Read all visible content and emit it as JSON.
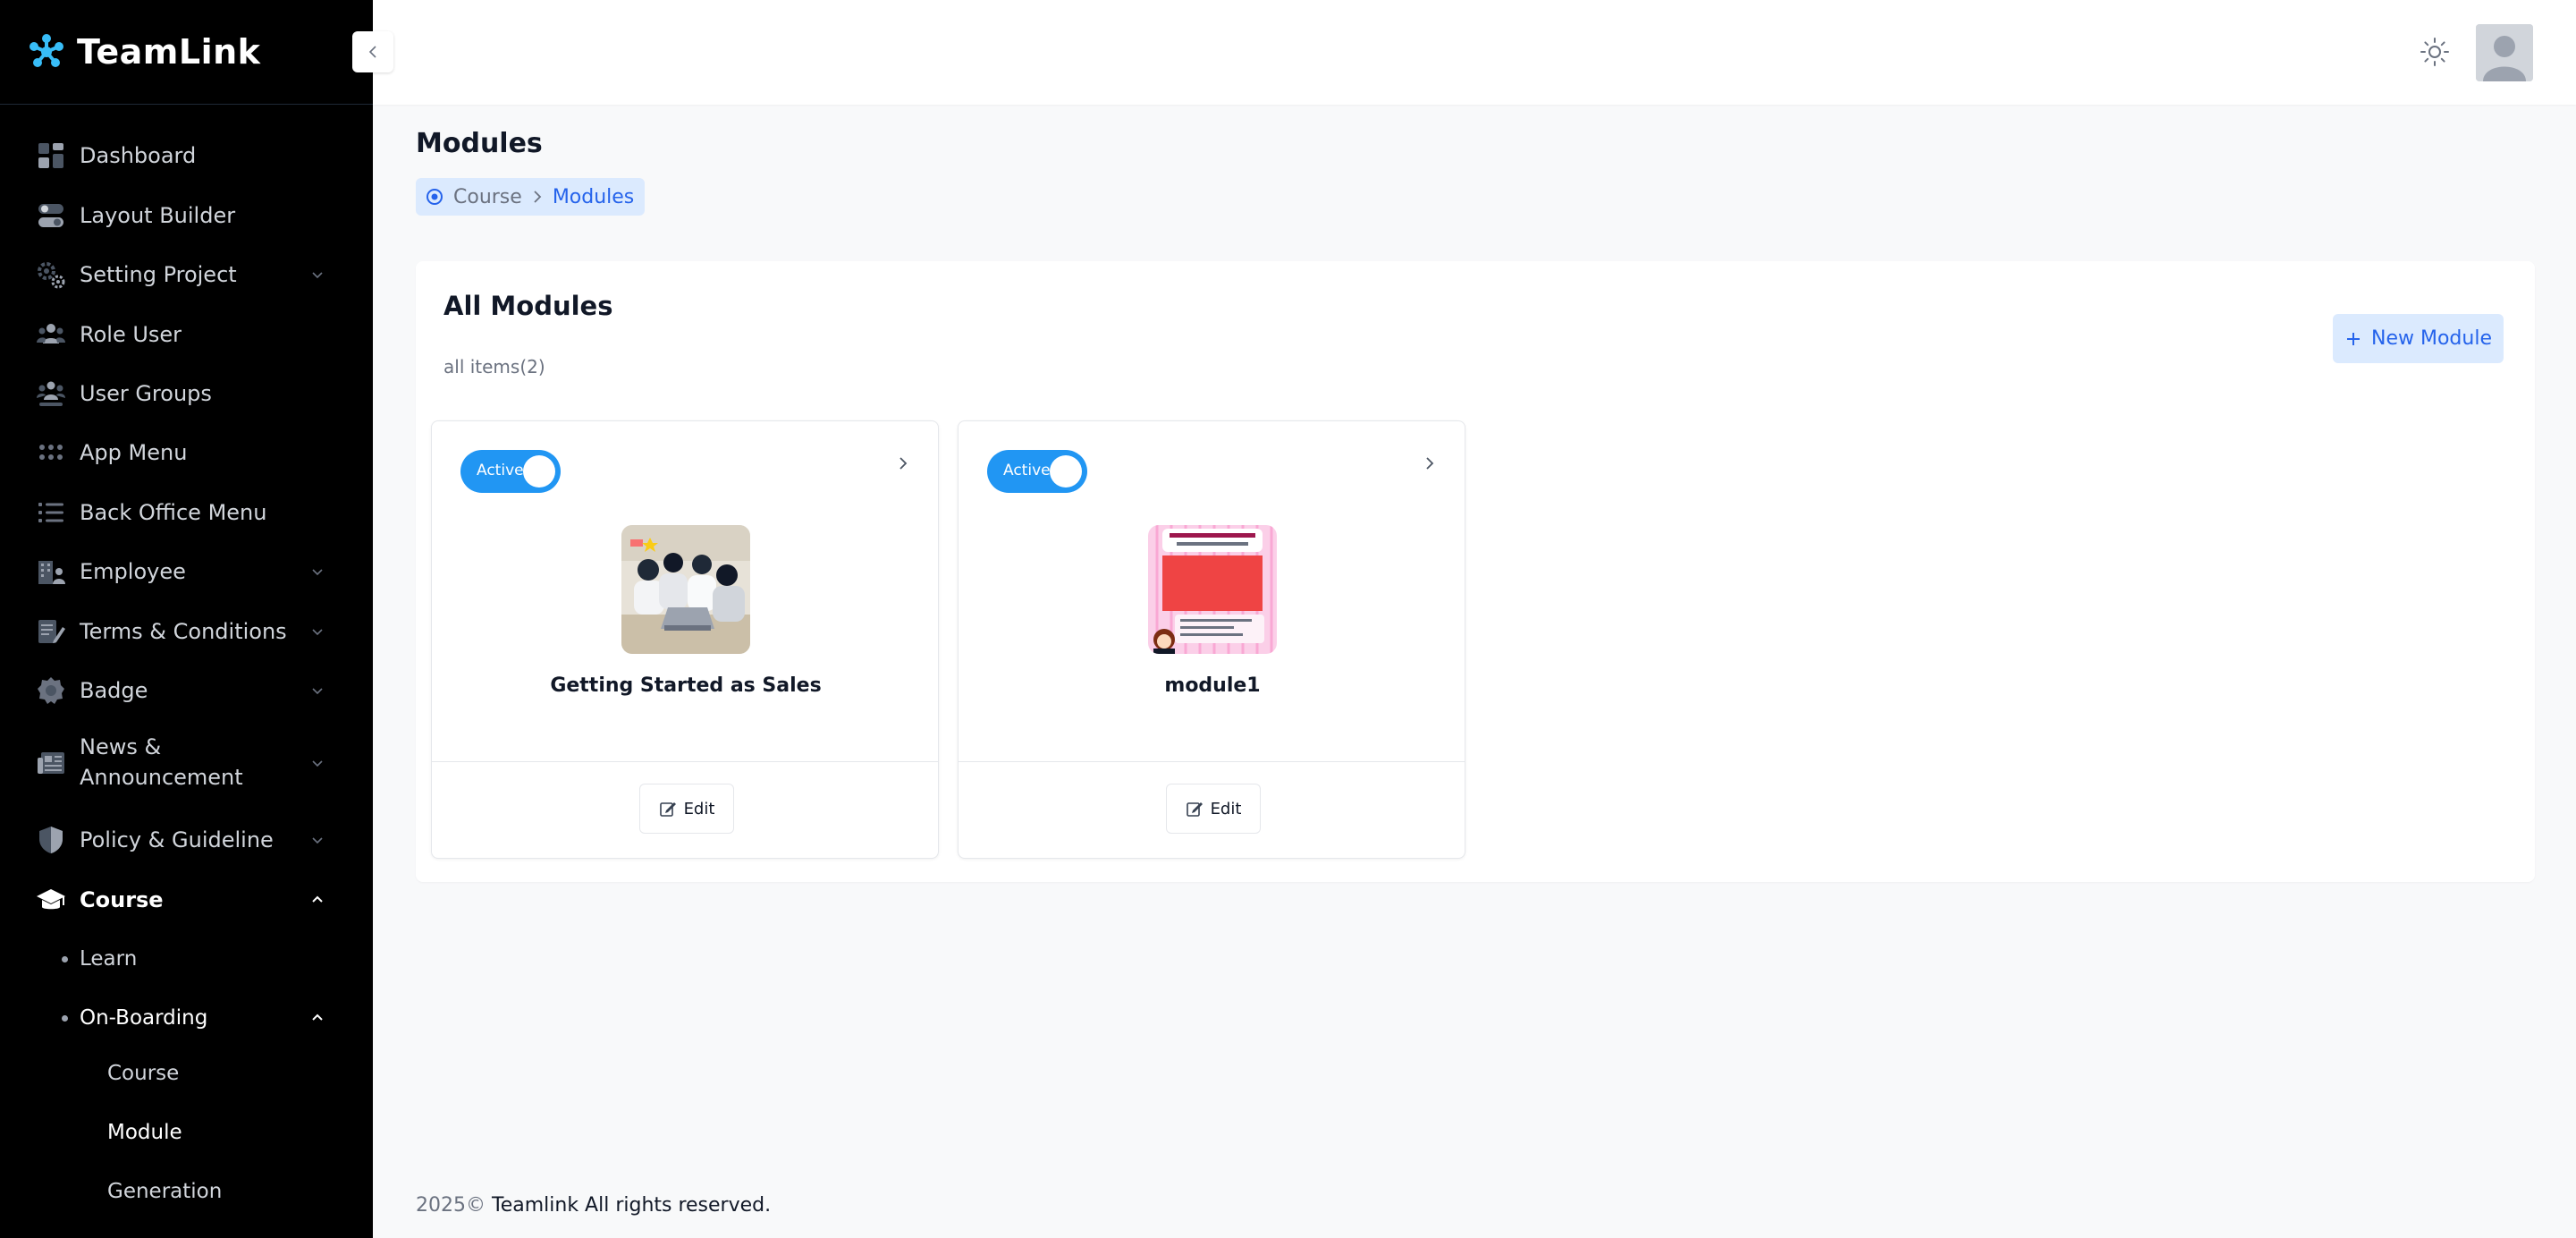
{
  "brand": {
    "name": "TeamLink"
  },
  "sidebar": {
    "items": [
      {
        "label": "Dashboard",
        "icon": "dashboard-icon"
      },
      {
        "label": "Layout Builder",
        "icon": "toggle-icon"
      },
      {
        "label": "Setting Project",
        "icon": "gears-icon",
        "expandable": true
      },
      {
        "label": "Role User",
        "icon": "users-icon"
      },
      {
        "label": "User Groups",
        "icon": "user-group-icon"
      },
      {
        "label": "App Menu",
        "icon": "grid-icon"
      },
      {
        "label": "Back Office Menu",
        "icon": "list-icon"
      },
      {
        "label": "Employee",
        "icon": "building-icon",
        "expandable": true
      },
      {
        "label": "Terms & Conditions",
        "icon": "contract-icon",
        "expandable": true
      },
      {
        "label": "Badge",
        "icon": "badge-icon",
        "expandable": true
      },
      {
        "label": "News &",
        "label2": "Announcement",
        "icon": "newspaper-icon",
        "expandable": true
      },
      {
        "label": "Policy & Guideline",
        "icon": "shield-icon",
        "expandable": true
      },
      {
        "label": "Course",
        "icon": "graduation-cap-icon",
        "expanded": true
      }
    ],
    "course_children": [
      {
        "label": "Learn"
      },
      {
        "label": "On-Boarding",
        "expanded": true
      }
    ],
    "onboarding_children": [
      {
        "label": "Course"
      },
      {
        "label": "Module",
        "active": true
      },
      {
        "label": "Generation"
      }
    ]
  },
  "header": {
    "theme_icon": "sun-icon",
    "avatar_icon": "user-avatar-icon"
  },
  "main": {
    "title": "Modules",
    "breadcrumb": {
      "parent": "Course",
      "current": "Modules"
    },
    "panel": {
      "title": "All Modules",
      "subtitle": "all items(2)",
      "new_button": "New Module"
    },
    "cards": [
      {
        "status": "Active",
        "title": "Getting Started as Sales",
        "edit_label": "Edit"
      },
      {
        "status": "Active",
        "title": "module1",
        "edit_label": "Edit"
      }
    ]
  },
  "footer": {
    "year": "2025©",
    "company": "Teamlink All rights reserved."
  },
  "colors": {
    "accent": "#2196f3",
    "link": "#2563eb",
    "sidebar_bg": "#000000"
  }
}
